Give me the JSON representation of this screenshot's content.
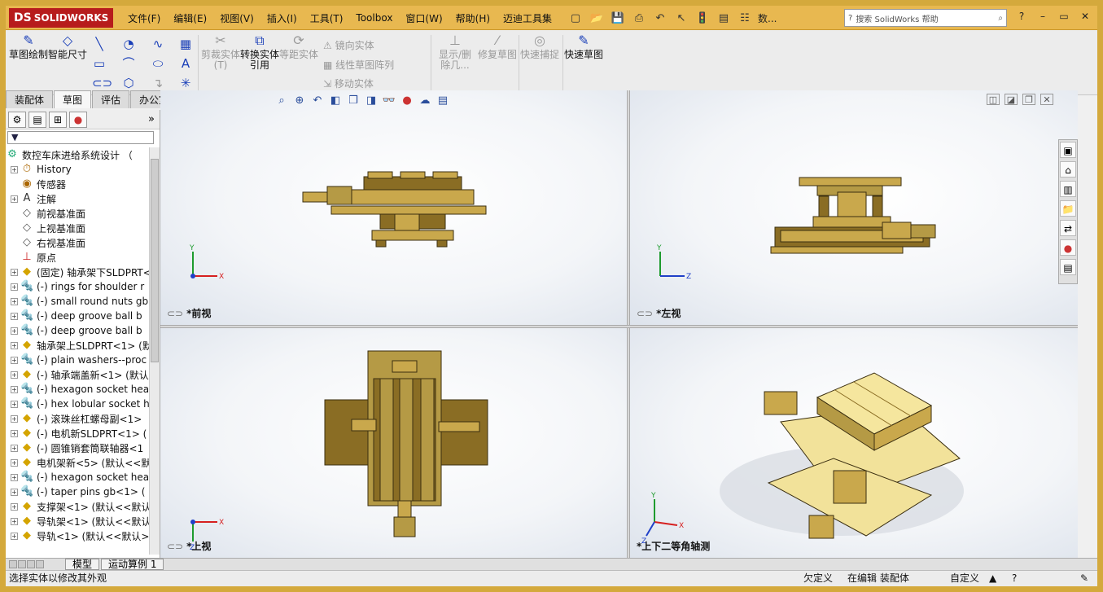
{
  "app": {
    "logo_brand": "DS",
    "logo_text": "SOLIDWORKS"
  },
  "menu": [
    "文件(F)",
    "编辑(E)",
    "视图(V)",
    "插入(I)",
    "工具(T)",
    "Toolbox",
    "窗口(W)",
    "帮助(H)",
    "迈迪工具集"
  ],
  "quick_access_text": "数...",
  "search": {
    "placeholder": "搜索 SolidWorks 帮助"
  },
  "ribbon": {
    "big": [
      {
        "label": "草图绘制",
        "enabled": true
      },
      {
        "label": "智能尺寸",
        "enabled": true
      },
      {
        "label": "剪裁实体(T)",
        "enabled": false
      },
      {
        "label": "转换实体引用",
        "enabled": true
      },
      {
        "label": "等距实体",
        "enabled": false
      },
      {
        "label": "显示/删除几...",
        "enabled": false
      },
      {
        "label": "修复草图",
        "enabled": false
      },
      {
        "label": "快速捕捉",
        "enabled": false
      },
      {
        "label": "快速草图",
        "enabled": true
      }
    ],
    "small": [
      "镜向实体",
      "线性草图阵列",
      "移动实体"
    ]
  },
  "tabs": [
    "装配体",
    "草图",
    "评估",
    "办公室产品"
  ],
  "active_tab": "草图",
  "tree": {
    "root": "数控车床进给系统设计 （",
    "items": [
      {
        "label": "History",
        "expand": true
      },
      {
        "label": "传感器",
        "expand": false
      },
      {
        "label": "注解",
        "expand": true
      },
      {
        "label": "前视基准面",
        "expand": false
      },
      {
        "label": "上视基准面",
        "expand": false
      },
      {
        "label": "右视基准面",
        "expand": false
      },
      {
        "label": "原点",
        "expand": false
      },
      {
        "label": "(固定) 轴承架下SLDPRT<",
        "expand": true
      },
      {
        "label": "(-) rings for shoulder r",
        "expand": true
      },
      {
        "label": "(-) small round nuts gb",
        "expand": true
      },
      {
        "label": "(-) deep groove ball b",
        "expand": true
      },
      {
        "label": "(-) deep groove ball b",
        "expand": true
      },
      {
        "label": "轴承架上SLDPRT<1> (默",
        "expand": true
      },
      {
        "label": "(-) plain washers--proc",
        "expand": true
      },
      {
        "label": "(-) 轴承端盖新<1> (默认",
        "expand": true
      },
      {
        "label": "(-) hexagon socket hea",
        "expand": true
      },
      {
        "label": "(-) hex lobular socket h",
        "expand": true
      },
      {
        "label": "(-) 滚珠丝杠螺母副<1>",
        "expand": true
      },
      {
        "label": "(-) 电机新SLDPRT<1> (",
        "expand": true
      },
      {
        "label": "(-) 圆锥销套筒联轴器<1",
        "expand": true
      },
      {
        "label": "电机架新<5> (默认<<默",
        "expand": true
      },
      {
        "label": "(-) hexagon socket hea",
        "expand": true
      },
      {
        "label": "(-) taper pins gb<1> (",
        "expand": true
      },
      {
        "label": "支撑架<1> (默认<<默认",
        "expand": true
      },
      {
        "label": "导轨架<1> (默认<<默认",
        "expand": true
      },
      {
        "label": "导轨<1> (默认<<默认>",
        "expand": true
      }
    ]
  },
  "bottom_tabs": [
    "模型",
    "运动算例 1"
  ],
  "views": {
    "front": "*前视",
    "left": "*左视",
    "top": "*上视",
    "iso": "*上下二等角轴测"
  },
  "axes": {
    "y": "Y",
    "x": "X",
    "z": "Z"
  },
  "status": {
    "hint": "选择实体以修改其外观",
    "defined": "欠定义",
    "editing": "在编辑 装配体",
    "custom": "自定义"
  },
  "colors": {
    "frame": "#d4a93c",
    "part": "#c9a84c",
    "part_dark": "#8a6d24",
    "axis_x": "#d62020",
    "axis_y": "#1e9b2e",
    "axis_z": "#2040c8"
  }
}
